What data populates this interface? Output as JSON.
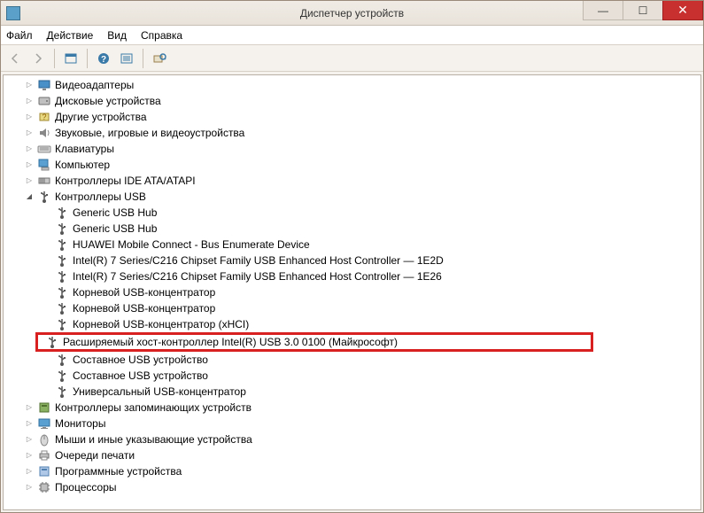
{
  "window": {
    "title": "Диспетчер устройств"
  },
  "menu": {
    "file": "Файл",
    "action": "Действие",
    "view": "Вид",
    "help": "Справка"
  },
  "tree": {
    "categories": [
      {
        "label": "Видеоадаптеры",
        "state": "closed",
        "icon": "display"
      },
      {
        "label": "Дисковые устройства",
        "state": "closed",
        "icon": "disk"
      },
      {
        "label": "Другие устройства",
        "state": "closed",
        "icon": "other"
      },
      {
        "label": "Звуковые, игровые и видеоустройства",
        "state": "closed",
        "icon": "sound"
      },
      {
        "label": "Клавиатуры",
        "state": "closed",
        "icon": "keyboard"
      },
      {
        "label": "Компьютер",
        "state": "closed",
        "icon": "computer"
      },
      {
        "label": "Контроллеры IDE ATA/ATAPI",
        "state": "closed",
        "icon": "ide"
      },
      {
        "label": "Контроллеры USB",
        "state": "open",
        "icon": "usb",
        "children": [
          {
            "label": "Generic USB Hub"
          },
          {
            "label": "Generic USB Hub"
          },
          {
            "label": "HUAWEI Mobile Connect - Bus Enumerate Device"
          },
          {
            "label": "Intel(R) 7 Series/C216 Chipset Family USB Enhanced Host Controller — 1E2D"
          },
          {
            "label": "Intel(R) 7 Series/C216 Chipset Family USB Enhanced Host Controller — 1E26"
          },
          {
            "label": "Корневой USB-концентратор"
          },
          {
            "label": "Корневой USB-концентратор"
          },
          {
            "label": "Корневой USB-концентратор (xHCI)"
          },
          {
            "label": "Расширяемый хост-контроллер Intel(R) USB 3.0 0100 (Майкрософт)",
            "highlight": true
          },
          {
            "label": "Составное USB устройство"
          },
          {
            "label": "Составное USB устройство"
          },
          {
            "label": "Универсальный USB-концентратор"
          }
        ]
      },
      {
        "label": "Контроллеры запоминающих устройств",
        "state": "closed",
        "icon": "storage"
      },
      {
        "label": "Мониторы",
        "state": "closed",
        "icon": "monitor"
      },
      {
        "label": "Мыши и иные указывающие устройства",
        "state": "closed",
        "icon": "mouse"
      },
      {
        "label": "Очереди печати",
        "state": "closed",
        "icon": "print"
      },
      {
        "label": "Программные устройства",
        "state": "closed",
        "icon": "software"
      },
      {
        "label": "Процессоры",
        "state": "closed",
        "icon": "cpu"
      }
    ]
  }
}
